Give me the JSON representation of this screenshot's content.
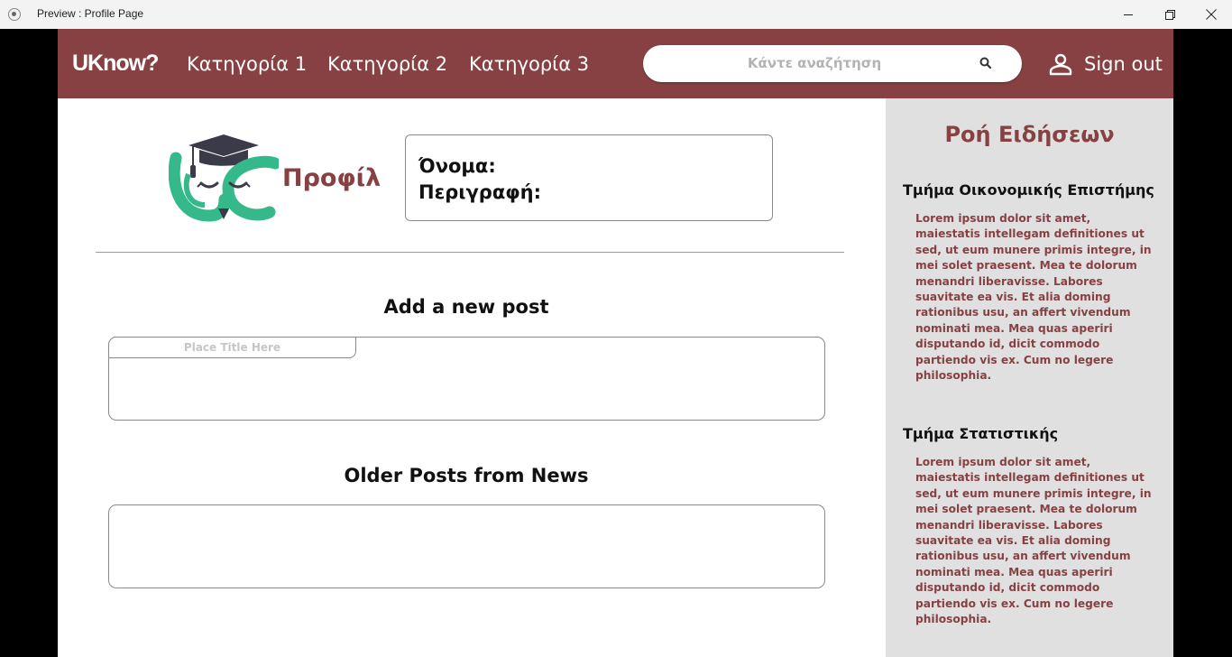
{
  "window": {
    "title": "Preview : Profile Page"
  },
  "header": {
    "logo": "UKnow?",
    "nav": [
      "Κατηγορία 1",
      "Κατηγορία 2",
      "Κατηγορία 3"
    ],
    "search_placeholder": "Κάντε αναζήτηση",
    "signout_label": "Sign out"
  },
  "profile": {
    "title": "Προφίλ",
    "name_label": "Όνομα:",
    "description_label": "Περιγραφή:"
  },
  "new_post": {
    "heading": "Add a new post",
    "title_placeholder": "Place Title Here"
  },
  "older_posts": {
    "heading": "Older Posts from News"
  },
  "news_feed": {
    "title": "Ροή Ειδήσεων",
    "items": [
      {
        "department": "Τμήμα Οικονομικής Επιστήμης",
        "body": "Lorem ipsum dolor sit amet, maiestatis intellegam definitiones ut sed, ut eum munere primis integre, in mei solet praesent. Mea te dolorum menandri liberavisse. Labores suavitate ea vis. Et alia doming rationibus usu, an affert vivendum nominati mea. Mea quas aperiri disputando id, dicit commodo partiendo vis ex. Cum no legere philosophia."
      },
      {
        "department": "Τμήμα Στατιστικής",
        "body": "Lorem ipsum dolor sit amet, maiestatis intellegam definitiones ut sed, ut eum munere primis integre, in mei solet praesent. Mea te dolorum menandri liberavisse. Labores suavitate ea vis. Et alia doming rationibus usu, an affert vivendum nominati mea. Mea quas aperiri disputando id, dicit commodo partiendo vis ex. Cum no legere philosophia."
      }
    ]
  },
  "colors": {
    "brand": "#874143",
    "owl_green": "#35b98b",
    "sidebar_bg": "#e0e0e0"
  },
  "icons": [
    "app-icon",
    "minimize-icon",
    "maximize-icon",
    "close-icon",
    "search-icon",
    "user-icon",
    "owl-logo-icon"
  ]
}
